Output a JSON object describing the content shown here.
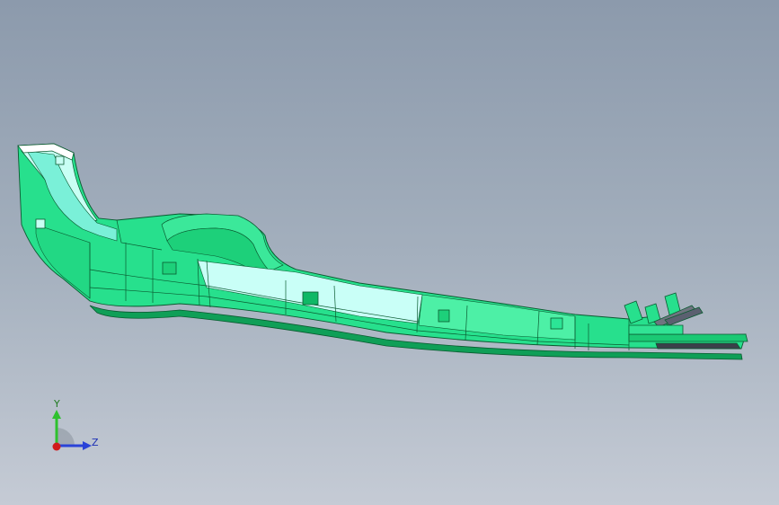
{
  "viewport": {
    "background_top": "#8c9aac",
    "background_bottom": "#c5cbd5"
  },
  "model": {
    "part": "sheet-metal-rail",
    "colors": {
      "face_main": "#27e08d",
      "face_light": "#c8fff4",
      "face_mid": "#7af0d8",
      "face_dark": "#12c46e",
      "edge": "#0a5a30"
    }
  },
  "triad": {
    "labels": {
      "y": "Y",
      "z": "Z"
    },
    "colors": {
      "y": "#2ec12e",
      "z": "#2a43d8",
      "x": "#d01c1c",
      "label_y": "#1f7a1f",
      "label_z": "#1b2fb5"
    }
  }
}
